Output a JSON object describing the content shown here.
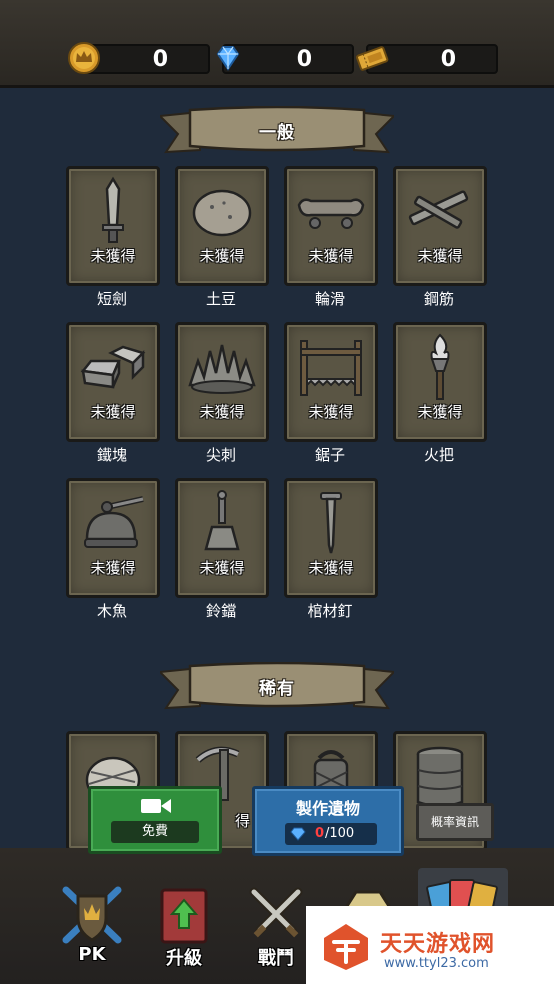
{
  "resources": [
    {
      "icon": "crown-coin-icon",
      "value": "0"
    },
    {
      "icon": "diamond-icon",
      "value": "0"
    },
    {
      "icon": "ticket-icon",
      "value": "0"
    }
  ],
  "sections": [
    {
      "title": "一般",
      "items": [
        {
          "name": "短劍",
          "status": "未獲得",
          "icon": "short-sword-icon"
        },
        {
          "name": "土豆",
          "status": "未獲得",
          "icon": "potato-icon"
        },
        {
          "name": "輪滑",
          "status": "未獲得",
          "icon": "skateboard-icon"
        },
        {
          "name": "鋼筋",
          "status": "未獲得",
          "icon": "steel-bar-icon"
        },
        {
          "name": "鐵塊",
          "status": "未獲得",
          "icon": "iron-block-icon"
        },
        {
          "name": "尖刺",
          "status": "未獲得",
          "icon": "spike-icon"
        },
        {
          "name": "鋸子",
          "status": "未獲得",
          "icon": "saw-icon"
        },
        {
          "name": "火把",
          "status": "未獲得",
          "icon": "torch-icon"
        },
        {
          "name": "木魚",
          "status": "未獲得",
          "icon": "wooden-fish-icon"
        },
        {
          "name": "鈴鐺",
          "status": "未獲得",
          "icon": "bell-icon"
        },
        {
          "name": "棺材釘",
          "status": "未獲得",
          "icon": "coffin-nail-icon"
        }
      ]
    },
    {
      "title": "稀有",
      "items": [
        {
          "name": "",
          "status": "",
          "icon": "bandage-icon"
        },
        {
          "name": "",
          "status": "得",
          "icon": "pickaxe-icon"
        },
        {
          "name": "",
          "status": "",
          "icon": "lantern-icon"
        },
        {
          "name": "",
          "status": "",
          "icon": "barrel-icon"
        }
      ]
    }
  ],
  "actions": {
    "free": {
      "label": "免費",
      "icon": "video-camera-icon"
    },
    "craft": {
      "title": "製作遺物",
      "cost_current": "0",
      "cost_total": "/100",
      "icon": "diamond-icon"
    },
    "odds": {
      "label": "概率資訊"
    }
  },
  "tabs": [
    {
      "label": "PK",
      "icon": "pk-shield-icon"
    },
    {
      "label": "升級",
      "icon": "upgrade-book-icon"
    },
    {
      "label": "戰鬥",
      "icon": "battle-swords-icon"
    },
    {
      "label": "",
      "icon": "tab-icon"
    },
    {
      "label": "",
      "icon": "cards-icon"
    }
  ],
  "watermark": {
    "title": "天天游戏网",
    "url": "www.ttyl23.com"
  },
  "colors": {
    "background": "#1f2b3b",
    "card": "#5a5544",
    "ribbon": "#9a8f74",
    "free_button": "#2f8f3c",
    "craft_button": "#2d6ea8",
    "cost_red": "#ff4040"
  }
}
